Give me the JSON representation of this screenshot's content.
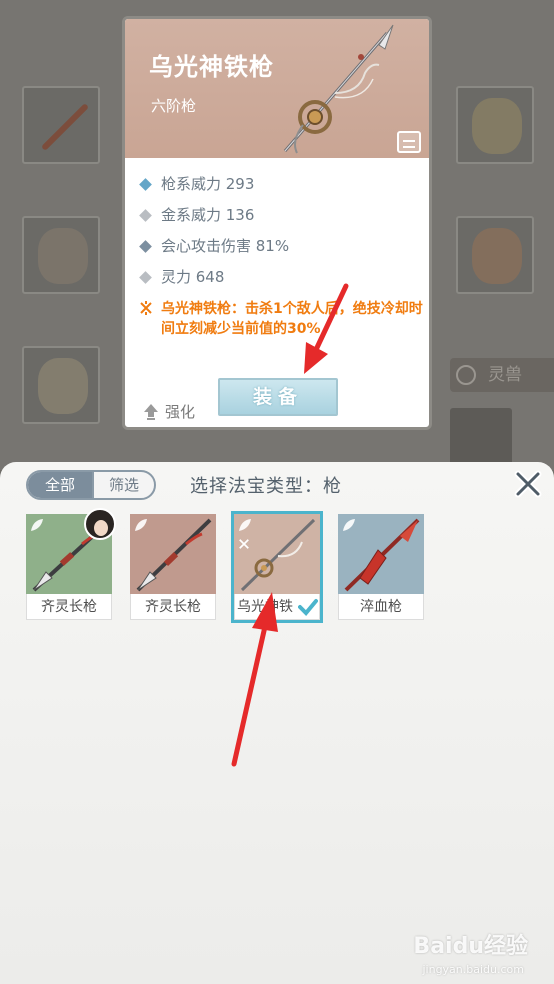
{
  "background": {
    "pet_tab_label": "灵兽"
  },
  "detail": {
    "name": "乌光神铁枪",
    "grade": "六阶枪",
    "stats": [
      {
        "label": "枪系威力 293",
        "color": "#64a6c8"
      },
      {
        "label": "金系威力 136",
        "color": "#b9bdc2"
      },
      {
        "label": "会心攻击伤害 81%",
        "color": "#7c8fa0"
      },
      {
        "label": "灵力 648",
        "color": "#b9bdc2"
      }
    ],
    "effect": "乌光神铁枪：击杀1个敌人后，绝技冷却时间立刻减少当前值的30%",
    "upgrade_label": "强化",
    "equip_label": "装备"
  },
  "panel": {
    "filter_all": "全部",
    "filter_screen": "筛选",
    "title": "选择法宝类型：枪",
    "close_label": "X",
    "items": [
      {
        "name": "齐灵长枪",
        "bg": "#8fb08a",
        "has_avatar": true,
        "selected": false
      },
      {
        "name": "齐灵长枪",
        "bg": "#c09a8e",
        "has_avatar": false,
        "selected": false
      },
      {
        "name": "乌光神铁",
        "bg": "#cfb3a5",
        "has_avatar": false,
        "selected": true
      },
      {
        "name": "淬血枪",
        "bg": "#9ab3c0",
        "has_avatar": false,
        "selected": false
      }
    ]
  },
  "watermark": {
    "brand": "Baidu经验",
    "url": "jingyan.baidu.com"
  }
}
